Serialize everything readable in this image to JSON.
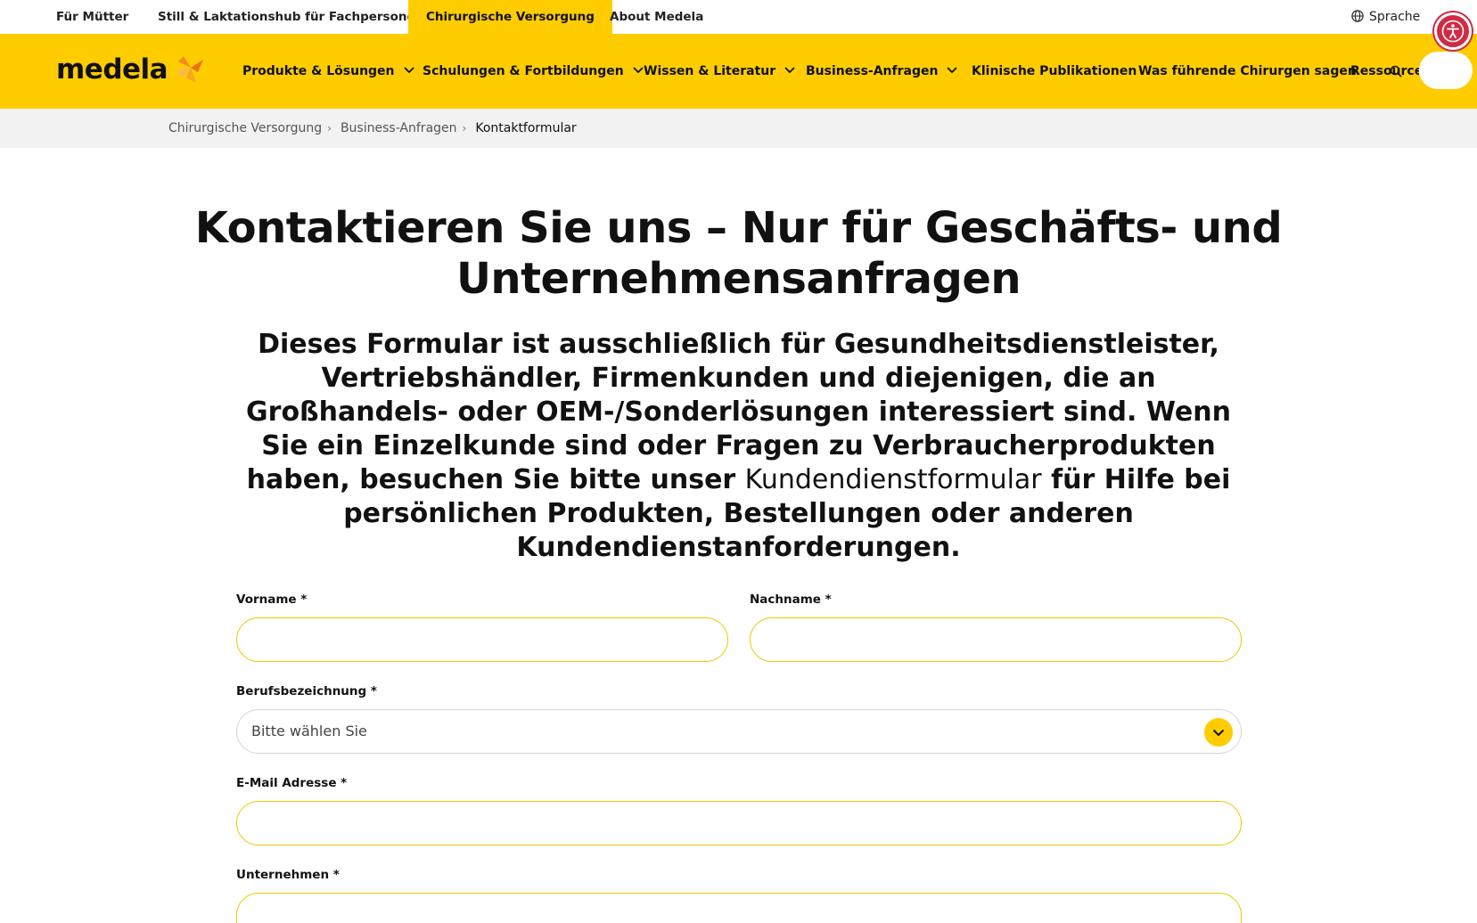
{
  "topbar": {
    "links": [
      "Für Mütter",
      "Still & Laktationshub für Fachpersonen",
      "Chirurgische Versorgung",
      "About Medela"
    ],
    "active_index": 2,
    "language_label": "Sprache"
  },
  "brand": {
    "logo_text": "medela"
  },
  "nav": {
    "items": [
      {
        "label": "Produkte & Lösungen",
        "has_dropdown": true
      },
      {
        "label": "Schulungen & Fortbildungen",
        "has_dropdown": true
      },
      {
        "label": "Wissen & Literatur",
        "has_dropdown": true
      },
      {
        "label": "Business-Anfragen",
        "has_dropdown": true
      },
      {
        "label": "Klinische Publikationen",
        "has_dropdown": false
      },
      {
        "label": "Was führende Chirurgen sagen",
        "has_dropdown": false
      },
      {
        "label": "Ressourcen",
        "has_dropdown": false
      }
    ]
  },
  "breadcrumb": [
    "Chirurgische Versorgung",
    "Business-Anfragen",
    "Kontaktformular"
  ],
  "page": {
    "title": "Kontaktieren Sie uns – Nur für Geschäfts- und Unternehmensanfragen",
    "intro_before_link": "Dieses Formular ist ausschließlich für Gesundheitsdienstleister, Vertriebshändler, Firmenkunden und diejenigen, die an Großhandels- oder OEM-/Sonderlösungen interessiert sind. Wenn Sie ein Einzelkunde sind oder Fragen zu Verbraucherprodukten haben, besuchen Sie bitte unser ",
    "intro_link": "Kundendienstformular",
    "intro_after_link": " für Hilfe bei persönlichen Produkten, Bestellungen oder anderen Kundendienstanforderungen."
  },
  "form": {
    "first_name": {
      "label": "Vorname *",
      "value": ""
    },
    "last_name": {
      "label": "Nachname *",
      "value": ""
    },
    "job_title": {
      "label": "Berufsbezeichnung *",
      "selected": "Bitte wählen Sie"
    },
    "email": {
      "label": "E-Mail Adresse *",
      "value": ""
    },
    "company": {
      "label": "Unternehmen *",
      "value": ""
    }
  },
  "colors": {
    "brand_yellow": "#ffcc00",
    "accessibility_red": "#cf2c44",
    "logo_orange": "#f28c1b"
  },
  "icons": [
    "globe-icon",
    "accessibility-icon",
    "chevron-down-icon",
    "search-icon",
    "chevron-right-icon",
    "medela-flower-logo-icon"
  ]
}
